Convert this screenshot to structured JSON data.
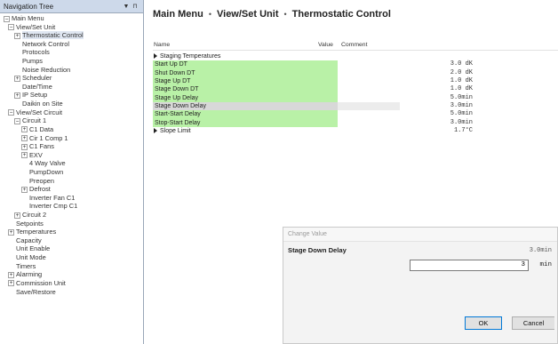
{
  "nav": {
    "title": "Navigation Tree",
    "dropdown_glyph": "▼",
    "pin_glyph": "⊓",
    "items": [
      {
        "label": "Main Menu",
        "level": 0,
        "exp": "−"
      },
      {
        "label": "View/Set Unit",
        "level": 1,
        "exp": "−"
      },
      {
        "label": "Thermostatic Control",
        "level": 2,
        "exp": "+",
        "selected": true
      },
      {
        "label": "Network Control",
        "level": 2,
        "exp": ""
      },
      {
        "label": "Protocols",
        "level": 2,
        "exp": ""
      },
      {
        "label": "Pumps",
        "level": 2,
        "exp": ""
      },
      {
        "label": "Noise Reduction",
        "level": 2,
        "exp": ""
      },
      {
        "label": "Scheduler",
        "level": 2,
        "exp": "+"
      },
      {
        "label": "Date/Time",
        "level": 2,
        "exp": ""
      },
      {
        "label": "IP Setup",
        "level": 2,
        "exp": "+"
      },
      {
        "label": "Daikin on Site",
        "level": 2,
        "exp": ""
      },
      {
        "label": "View/Set Circuit",
        "level": 1,
        "exp": "−"
      },
      {
        "label": "Circuit 1",
        "level": 2,
        "exp": "−"
      },
      {
        "label": "C1 Data",
        "level": 3,
        "exp": "+"
      },
      {
        "label": "Cir 1 Comp 1",
        "level": 3,
        "exp": "+"
      },
      {
        "label": "C1 Fans",
        "level": 3,
        "exp": "+"
      },
      {
        "label": "EXV",
        "level": 3,
        "exp": "+"
      },
      {
        "label": "4 Way Valve",
        "level": 3,
        "exp": ""
      },
      {
        "label": "PumpDown",
        "level": 3,
        "exp": ""
      },
      {
        "label": "Preopen",
        "level": 3,
        "exp": ""
      },
      {
        "label": "Defrost",
        "level": 3,
        "exp": "+"
      },
      {
        "label": "Inverter Fan C1",
        "level": 3,
        "exp": ""
      },
      {
        "label": "Inverter Cmp C1",
        "level": 3,
        "exp": ""
      },
      {
        "label": "Circuit 2",
        "level": 2,
        "exp": "+"
      },
      {
        "label": "Setpoints",
        "level": 1,
        "exp": ""
      },
      {
        "label": "Temperatures",
        "level": 1,
        "exp": "+"
      },
      {
        "label": "Capacity",
        "level": 1,
        "exp": ""
      },
      {
        "label": "Unit Enable",
        "level": 1,
        "exp": ""
      },
      {
        "label": "Unit Mode",
        "level": 1,
        "exp": ""
      },
      {
        "label": "Timers",
        "level": 1,
        "exp": ""
      },
      {
        "label": "Alarming",
        "level": 1,
        "exp": "+"
      },
      {
        "label": "Commission Unit",
        "level": 1,
        "exp": "+"
      },
      {
        "label": "Save/Restore",
        "level": 1,
        "exp": ""
      }
    ]
  },
  "breadcrumb": {
    "items": [
      "Main Menu",
      "View/Set Unit",
      "Thermostatic Control"
    ],
    "separator": "•"
  },
  "grid": {
    "headers": {
      "name": "Name",
      "value": "Value",
      "comment": "Comment"
    },
    "rows": [
      {
        "name": "Staging Temperatures",
        "value": "",
        "style": "group"
      },
      {
        "name": "Start Up DT",
        "value": "3.0 dK",
        "style": "green"
      },
      {
        "name": "Shut Down DT",
        "value": "2.0 dK",
        "style": "green"
      },
      {
        "name": "Stage Up DT",
        "value": "1.0 dK",
        "style": "green"
      },
      {
        "name": "Stage Down DT",
        "value": "1.0 dK",
        "style": "green"
      },
      {
        "name": "Stage Up Delay",
        "value": "5.0min",
        "style": "green"
      },
      {
        "name": "Stage Down Delay",
        "value": "3.0min",
        "style": "sel"
      },
      {
        "name": "Start-Start Delay",
        "value": "5.0min",
        "style": "green"
      },
      {
        "name": "Stop-Start Delay",
        "value": "3.0min",
        "style": "green"
      },
      {
        "name": "Slope Limit",
        "value": "1.7°C",
        "style": "group"
      }
    ]
  },
  "dialog": {
    "title": "Change Value",
    "label": "Stage Down Delay",
    "current_value": "3.0min",
    "input_value": "3",
    "unit": "min",
    "ok_label": "OK",
    "cancel_label": "Cancel"
  }
}
